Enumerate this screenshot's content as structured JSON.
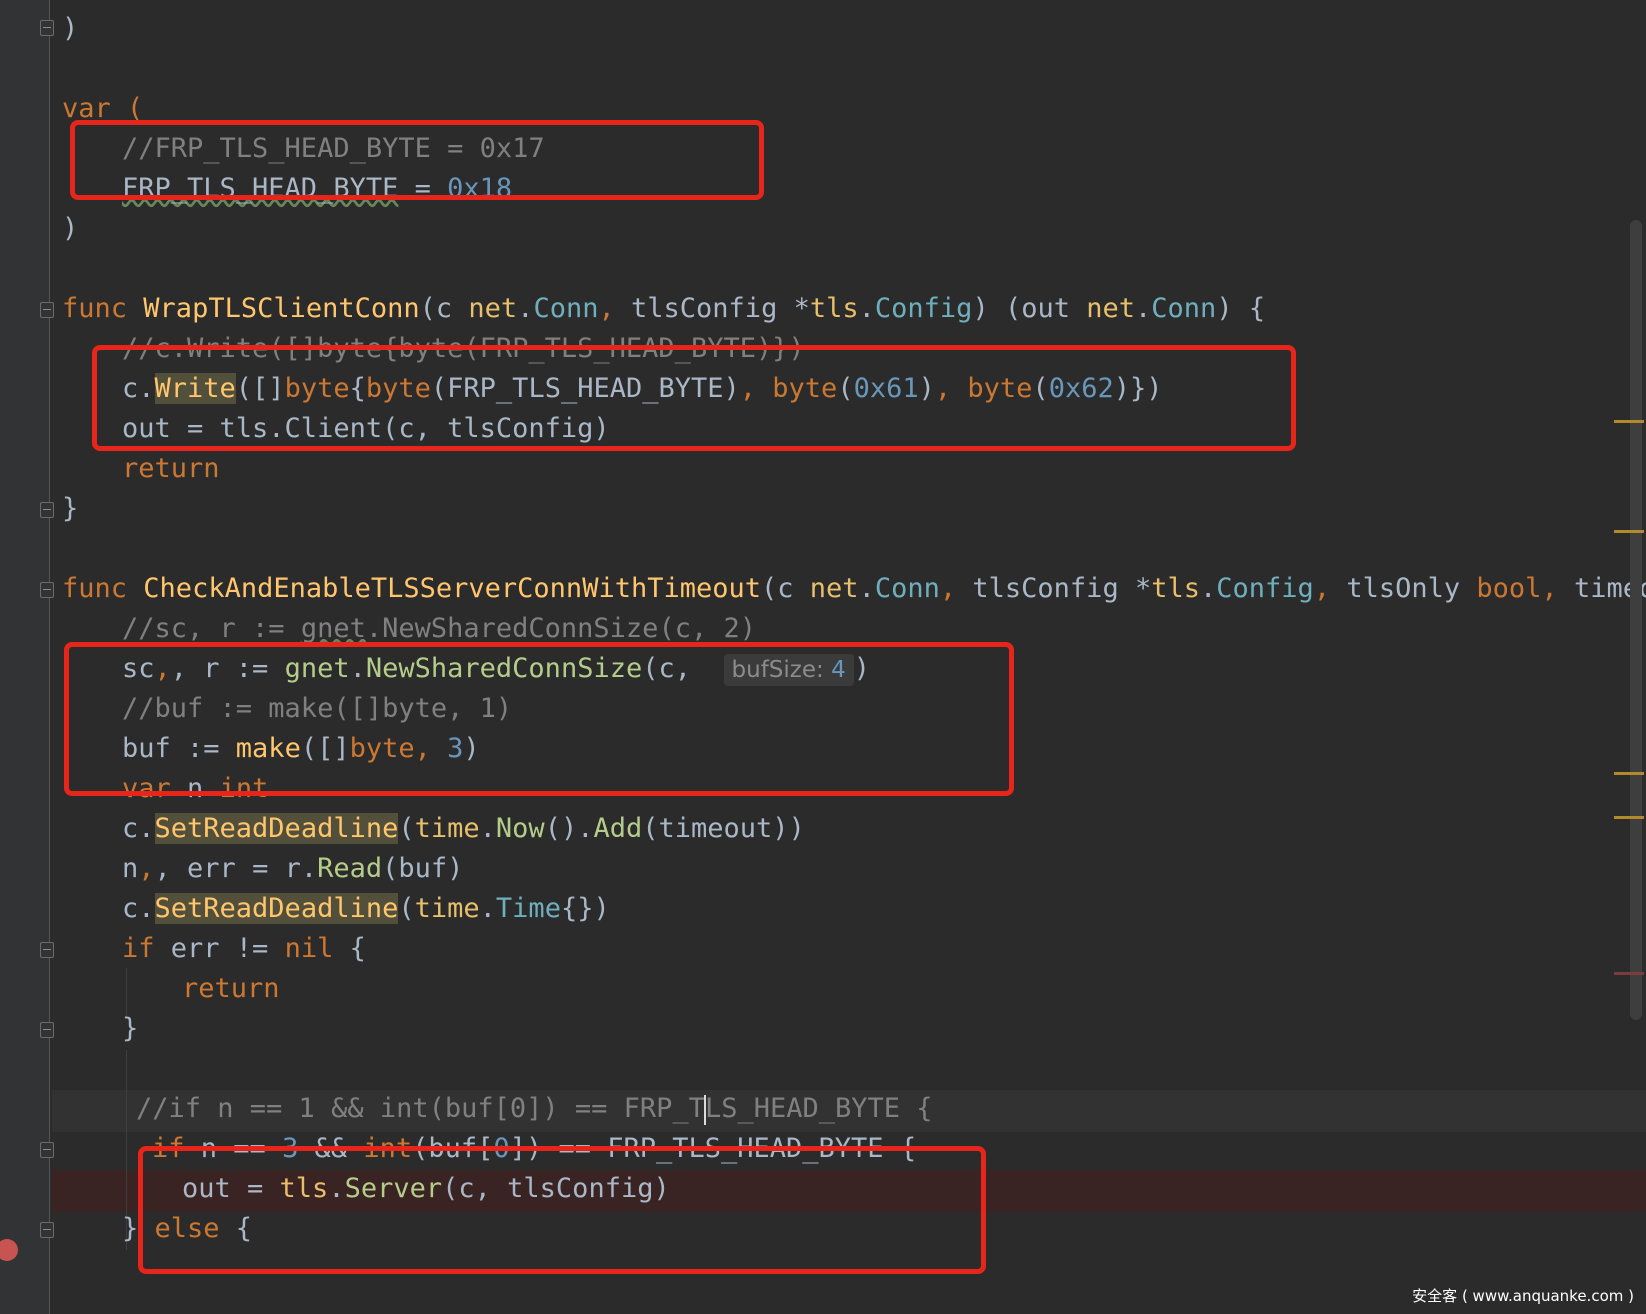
{
  "editor": {
    "lines": {
      "l1": ")",
      "l2": "var (",
      "l3": "//FRP_TLS_HEAD_BYTE = 0x17",
      "l4_name": "FRP_TLS_HEAD_BYTE",
      "l4_eq": " = ",
      "l4_val": "0x18",
      "l5": ")",
      "f1_kw": "func",
      "f1_name": "WrapTLSClientConn",
      "f1_p1": "(c ",
      "f1_net": "net",
      "f1_dot": ".",
      "f1_conn": "Conn",
      "f1_comma": ",",
      "f1_p2": " tlsConfig *",
      "f1_tls": "tls",
      "f1_cfg": "Config",
      "f1_p3": ") (out ",
      "f1_net2": "net",
      "f1_conn2": "Conn",
      "f1_p4": ") {",
      "f1_c1": "//c.Write([]byte{byte(FRP_TLS_HEAD_BYTE)})",
      "f1_w_c": "c.",
      "f1_w_m": "Write",
      "f1_w_a": "([]",
      "f1_w_byte": "byte",
      "f1_w_b": "{",
      "f1_w_byte2": "byte",
      "f1_w_c2": "(FRP_TLS_HEAD_BYTE)",
      "f1_w_comma": ", ",
      "f1_w_byte3": "byte",
      "f1_w_n1": "0x61",
      "f1_w_byte4": "byte",
      "f1_w_n2": "0x62",
      "f1_w_end": ")})",
      "f1_out": "out = tls.Client(c, tlsConfig)",
      "f1_ret": "return",
      "f1_close": "}",
      "f2_kw": "func",
      "f2_name": "CheckAndEnableTLSServerConnWithTimeout",
      "f2_p1": "(c ",
      "f2_net": "net",
      "f2_conn": "Conn",
      "f2_p2": " tlsConfig *",
      "f2_tls": "tls",
      "f2_cfg": "Config",
      "f2_p3": " tlsOnly ",
      "f2_bool": "bool",
      "f2_p4": " timeou",
      "f2_c1a": "//sc, r := ",
      "f2_c1b": "gnet",
      "f2_c1c": ".NewSharedConnSize(c, 2)",
      "f2_sc_a": "sc",
      "f2_sc_b": ", r := ",
      "f2_sc_pkg": "gnet",
      "f2_sc_m": "NewSharedConnSize",
      "f2_sc_c": "(c, ",
      "f2_hint": "bufSize:",
      "f2_sc_n": "4",
      "f2_sc_end": ")",
      "f2_c2": "//buf := make([]byte, 1)",
      "f2_buf_a": "buf := ",
      "f2_buf_make": "make",
      "f2_buf_b": "([]",
      "f2_buf_byte": "byte",
      "f2_buf_c": ", ",
      "f2_buf_n": "3",
      "f2_buf_end": ")",
      "f2_var": "var",
      "f2_var_n": " n ",
      "f2_var_int": "int",
      "f2_srd_c": "c.",
      "f2_srd_m": "SetReadDeadline",
      "f2_srd_a": "(",
      "f2_srd_time": "time",
      "f2_srd_now": "Now",
      "f2_srd_b": "().",
      "f2_srd_add": "Add",
      "f2_srd_end": "(timeout))",
      "f2_read_a": "n",
      "f2_read_b": ", err = r.",
      "f2_read_m": "Read",
      "f2_read_end": "(buf)",
      "f2_srd2_c": "c.",
      "f2_srd2_m": "SetReadDeadline",
      "f2_srd2_a": "(",
      "f2_srd2_time": "time",
      "f2_srd2_t": "Time",
      "f2_srd2_end": "{})",
      "f2_if": "if",
      "f2_if_b": " err != ",
      "f2_nil": "nil",
      "f2_if_end": " {",
      "f2_ret": "return",
      "f2_close1": "}",
      "f2_c3a": "//if n == 1 && int(buf[0]) == FRP_T",
      "f2_c3b": "LS_HEAD_BYTE {",
      "f2_if2": "if",
      "f2_if2_a": " n == ",
      "f2_if2_n": "3",
      "f2_if2_b": " && ",
      "f2_if2_int": "int",
      "f2_if2_c": "(buf[",
      "f2_if2_n0": "0",
      "f2_if2_d": "]) == FRP_TLS_HEAD_BYTE {",
      "f2_out_a": "out = ",
      "f2_out_pkg": "tls",
      "f2_out_m": "Server",
      "f2_out_end": "(c, tlsConfig)",
      "f2_else_a": "} ",
      "f2_else": "else",
      "f2_else_b": " {"
    }
  },
  "watermark": "安全客 ( www.anquanke.com )",
  "colors": {
    "background": "#2b2b2b",
    "keyword": "#cc7832",
    "function": "#ffc66d",
    "comment": "#808080",
    "number": "#6897bb",
    "annotation_box": "#e8251b",
    "breakpoint": "#c75450"
  }
}
